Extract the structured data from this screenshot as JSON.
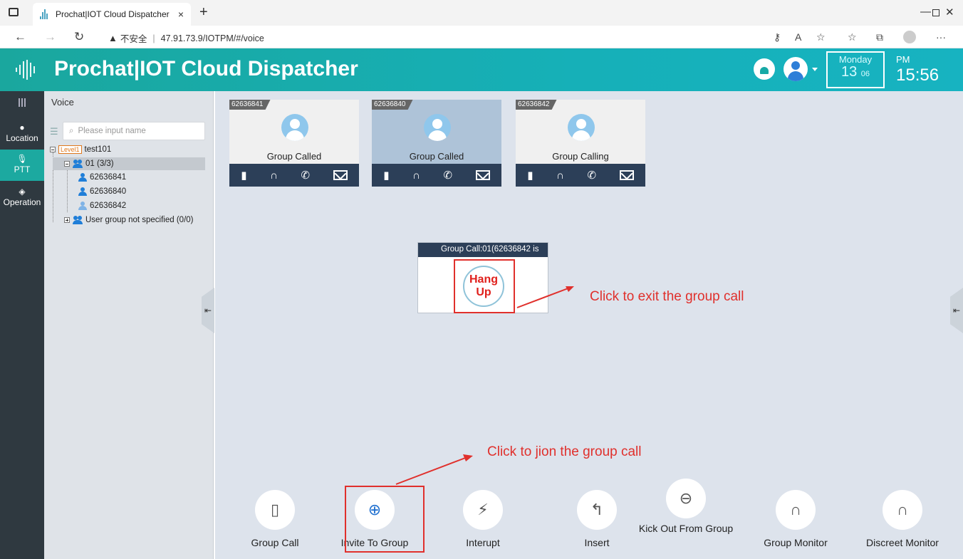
{
  "browser": {
    "tab_title": "Prochat|IOT Cloud Dispatcher",
    "tab_close": "×",
    "new_tab": "+",
    "security_label": "不安全",
    "url": "47.91.73.9/IOTPM/#/voice",
    "url_sep": "|"
  },
  "header": {
    "app_title": "Prochat|IOT Cloud Dispatcher",
    "day_of_week": "Monday",
    "day": "13",
    "month": "06",
    "ampm": "PM",
    "time": "15:56",
    "colors": {
      "header_start": "#1aa79e",
      "header_end": "#17b3c1"
    }
  },
  "left_nav": {
    "items": [
      {
        "label": "Location",
        "icon": "location-pin-icon"
      },
      {
        "label": "PTT",
        "icon": "microphone-icon",
        "active": true
      },
      {
        "label": "Operation",
        "icon": "layers-icon"
      }
    ]
  },
  "tree_panel": {
    "title": "Voice",
    "search_placeholder": "Please input name",
    "level_tag": "Level1",
    "root": "test101",
    "group": "01 (3/3)",
    "members": [
      "62636841",
      "62636840",
      "62636842"
    ],
    "unassigned": "User group not specified (0/0)"
  },
  "cards": [
    {
      "id": "62636841",
      "status": "Group Called",
      "active": false
    },
    {
      "id": "62636840",
      "status": "Group Called",
      "active": true
    },
    {
      "id": "62636842",
      "status": "Group Calling",
      "active": false
    }
  ],
  "call_popup": {
    "header": "Group Call:01(62636842 is",
    "hang_up_line1": "Hang",
    "hang_up_line2": "Up"
  },
  "annotations": {
    "exit_note": "Click to exit the group call",
    "join_note": "Click to jion the group call",
    "color": "#e0302c"
  },
  "bottom_actions": [
    {
      "label": "Group Call",
      "icon": "walkie-talkie-icon"
    },
    {
      "label": "Invite To Group",
      "icon": "invite-group-icon"
    },
    {
      "label": "Interupt",
      "icon": "interrupt-icon"
    },
    {
      "label": "Insert",
      "icon": "insert-icon"
    },
    {
      "label": "Kick Out From Group",
      "icon": "kick-out-icon"
    },
    {
      "label": "Group Monitor",
      "icon": "group-monitor-headset-icon"
    },
    {
      "label": "Discreet Monitor",
      "icon": "discreet-monitor-headset-icon"
    }
  ]
}
